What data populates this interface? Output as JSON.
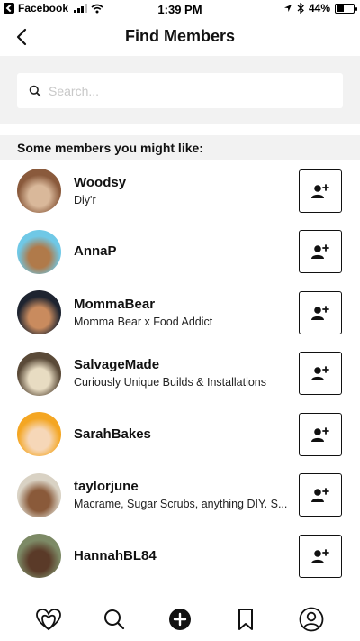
{
  "status_bar": {
    "back_app": "Facebook",
    "time": "1:39 PM",
    "battery": "44%",
    "battery_level": 0.44
  },
  "header": {
    "title": "Find Members"
  },
  "search": {
    "placeholder": "Search...",
    "value": ""
  },
  "section": {
    "title": "Some members you might like:"
  },
  "members": [
    {
      "name": "Woodsy",
      "bio": "Diy'r",
      "avatar_colors": [
        "#8a5a3c",
        "#d9b89a"
      ]
    },
    {
      "name": "AnnaP",
      "bio": "",
      "avatar_colors": [
        "#6fc8e6",
        "#b07a4a"
      ]
    },
    {
      "name": "MommaBear",
      "bio": "Momma Bear x Food Addict",
      "avatar_colors": [
        "#1e2430",
        "#c98b5e"
      ]
    },
    {
      "name": "SalvageMade",
      "bio": "Curiously Unique Builds & Installations",
      "avatar_colors": [
        "#5a4a38",
        "#e8dcc2"
      ]
    },
    {
      "name": "SarahBakes",
      "bio": "",
      "avatar_colors": [
        "#f4a623",
        "#f6d7b8"
      ]
    },
    {
      "name": "taylorjune",
      "bio": "Macrame, Sugar Scrubs, anything DIY.  S...",
      "avatar_colors": [
        "#d9d2c4",
        "#8a5a3a"
      ]
    },
    {
      "name": "HannahBL84",
      "bio": "",
      "avatar_colors": [
        "#7d8a66",
        "#5a3a28"
      ]
    }
  ],
  "tab_bar": {
    "tabs": [
      {
        "icon": "community-icon",
        "label": "Community"
      },
      {
        "icon": "search-icon",
        "label": "Search"
      },
      {
        "icon": "add-icon",
        "label": "Create"
      },
      {
        "icon": "bookmark-icon",
        "label": "Saved"
      },
      {
        "icon": "profile-icon",
        "label": "Profile"
      }
    ]
  }
}
